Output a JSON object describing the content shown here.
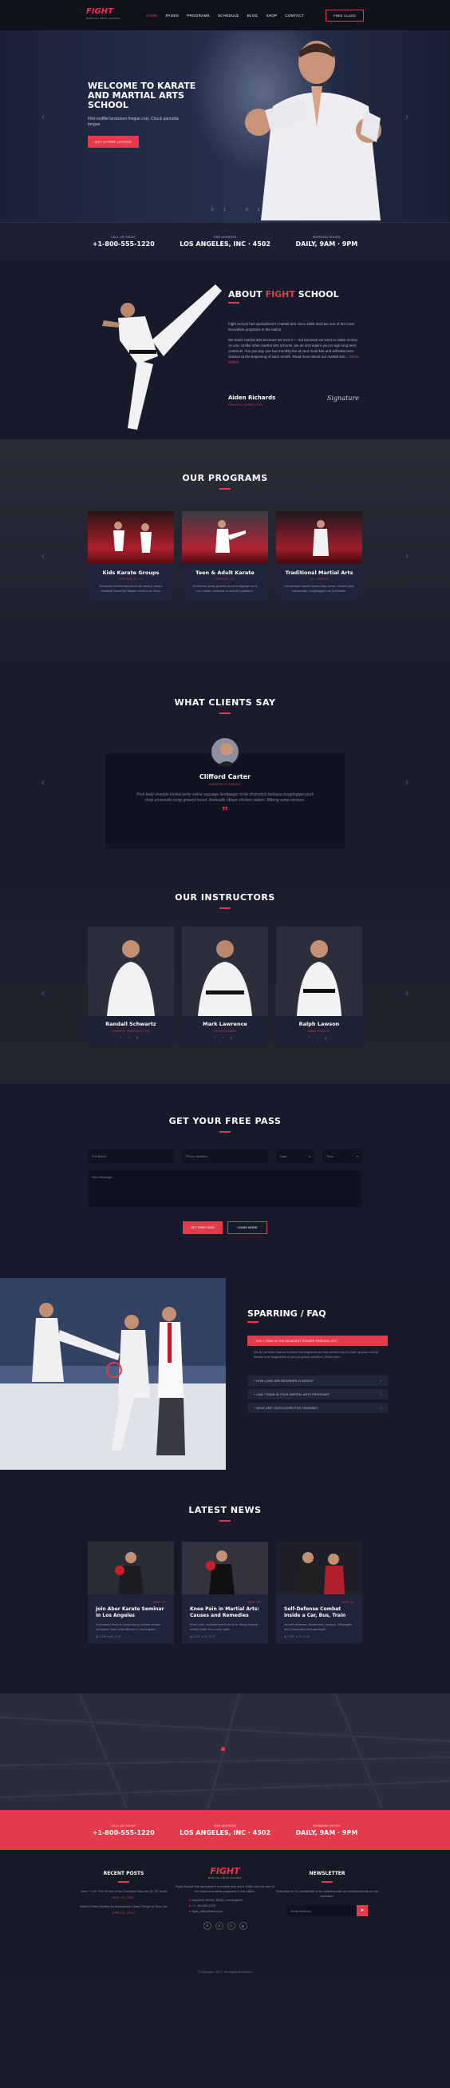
{
  "header": {
    "logo": "FIGHT",
    "logo_sub": "MARTIAL ARTS SCHOOL",
    "nav": [
      "HOME",
      "PAGES",
      "PROGRAMS",
      "SCHEDULE",
      "BLOG",
      "SHOP",
      "CONTACT"
    ],
    "cta": "FREE CLASS"
  },
  "hero": {
    "title": "WELCOME TO KARATE AND MARTIAL ARTS SCHOOL",
    "subtitle": "Filet mufflet turducken fongue cray. Chuck pancetta tongue.",
    "button": "GET A FREE LESSON",
    "pager": "01 02"
  },
  "info_strip": [
    {
      "label": "CALL US TODAY",
      "value": "+1-800-555-1220"
    },
    {
      "label": "OUR ADDRESS",
      "value": "LOS ANGELES, INC · 4502"
    },
    {
      "label": "WORKING HOURS",
      "value": "DAILY, 9AM · 9PM"
    }
  ],
  "about": {
    "title_pre": "ABOUT",
    "title_accent": "FIGHT",
    "title_post": "SCHOOL",
    "p1": "Fight School has specialized in martial arts since 1986 and has one of the most innovative programs in the nation.",
    "p2": "We teach martial arts because we love it — not because we want to make money on you. Unlike other martial arts schools, we do not require you to sign long term contracts. You just pay one low monthly fee at your meal kits and will takecover classes at the beginning of each month. Read more about our martial arts...",
    "read_more": "READ MORE",
    "name": "Aiden Richards",
    "role": "SCHOOL DIRECTOR",
    "signature": "Signature"
  },
  "programs": {
    "title": "OUR PROGRAMS",
    "items": [
      {
        "title": "Kids Karate Groups",
        "sub": "FOR AGE 5 – 12",
        "desc": "Bresaola beef tenderloin tri-tip salami, stroke meatloaf andouille ribeye chuck pork chop."
      },
      {
        "title": "Teen & Adult Karate",
        "sub": "FOR AGE 13+",
        "desc": "Tenderloin jerky ground round landjaeger pork loin cupim, leberkas prosciutto pastrami."
      },
      {
        "title": "Traditional Martial Arts",
        "sub": "ALL LEVELS",
        "desc": "Hamburger salami shank strip steak, chicken jowl hamburger, burgdoggen tail porchetta."
      }
    ]
  },
  "clients": {
    "title": "WHAT CLIENTS SAY",
    "name": "Clifford Carter",
    "role": "KARATE STUDENT",
    "quote": "Pork belly shankle brisket jerky swine sausage landjaeger tri-tip drumstick kielbasa burgdoggen pork chop prosciutto rump ground round. Andouille ribeye chicken salami. Biltong rump venison."
  },
  "instructors": {
    "title": "OUR INSTRUCTORS",
    "items": [
      {
        "name": "Randall Schwartz",
        "role": "KARATE INSTRUCTOR"
      },
      {
        "name": "Mark Lawrence",
        "role": "KICKBOXING"
      },
      {
        "name": "Ralph Lawson",
        "role": "MMA COACH"
      }
    ]
  },
  "pass": {
    "title": "GET YOUR FREE PASS",
    "name_ph": "Full Name",
    "phone_ph": "Phone Number",
    "date_ph": "Date",
    "time_ph": "Time",
    "msg_ph": "Your Message",
    "send": "GET FREE PASS",
    "info": "LEARN MORE"
  },
  "sparring": {
    "title": "SPARRING / FAQ",
    "items": [
      {
        "q": "MAY I PARK IN THE ADJACENT PRIVATE PARKING LOT?",
        "open": true
      },
      {
        "q": "HOW LONG ARE BEGINNER CLASSES?",
        "open": false
      },
      {
        "q": "CAN I TRAIN IN YOUR MARTIAL ARTS PROGRAM?",
        "open": false
      },
      {
        "q": "WHAT ARE YOUR DOORS FOR TRAINING?",
        "open": false
      }
    ],
    "answer": "We do all fruits that our trainers for beginners are the perfect way to start up your overall fitness level regardless of your physical condition. Read more."
  },
  "news": {
    "title": "LATEST NEWS",
    "items": [
      {
        "title": "Join Aber Karate Seminar in Los Angeles",
        "date": "MAY 12",
        "desc": "A pleasant head is conjuring up whose search complete. Aber with offered in Los Angeles.",
        "views": "1,248",
        "likes": "68",
        "comments": "24"
      },
      {
        "title": "Knee Pain in Martial Arts: Causes and Remedies",
        "date": "APR 28",
        "desc": "Knee pain, experienced from time. Many martial artists suffer from knee pain.",
        "views": "1,024",
        "likes": "31",
        "comments": "17"
      },
      {
        "title": "Self-Defense Combat Inside a Car, Bus, Train",
        "date": "APR 06",
        "desc": "As with defense, awareness, escape. Strategies also prevention and spectrum.",
        "views": "1,580",
        "likes": "72",
        "comments": "38"
      }
    ]
  },
  "footer": {
    "recent_title": "RECENT POSTS",
    "recent": [
      {
        "t": "Gear + Life: The Secret of the Greatest Samurai On 30 Years",
        "d": "MAY 09, 2017"
      },
      {
        "t": "Make It Free Healthy for Acceptable Chain Things In Your Life",
        "d": "APR 24, 2017"
      }
    ],
    "about_text": "Fight School has specialized in martial arts since 1986 and has one of the most innovative programs in the nation.",
    "address": "Isayanck Street, 48/12, Los Angeles",
    "phone": "+1 -80-555-1220",
    "email": "fight_office@fest.com",
    "news_title": "NEWSLETTER",
    "news_text": "Subscribe to our newsletter to be updated with our newest events on the schedule.",
    "news_ph": "Email Address",
    "copyright": "© Copyright 2017. All Rights Reserved."
  },
  "colors": {
    "accent": "#e33a4c",
    "bg": "#1a1c2b"
  }
}
